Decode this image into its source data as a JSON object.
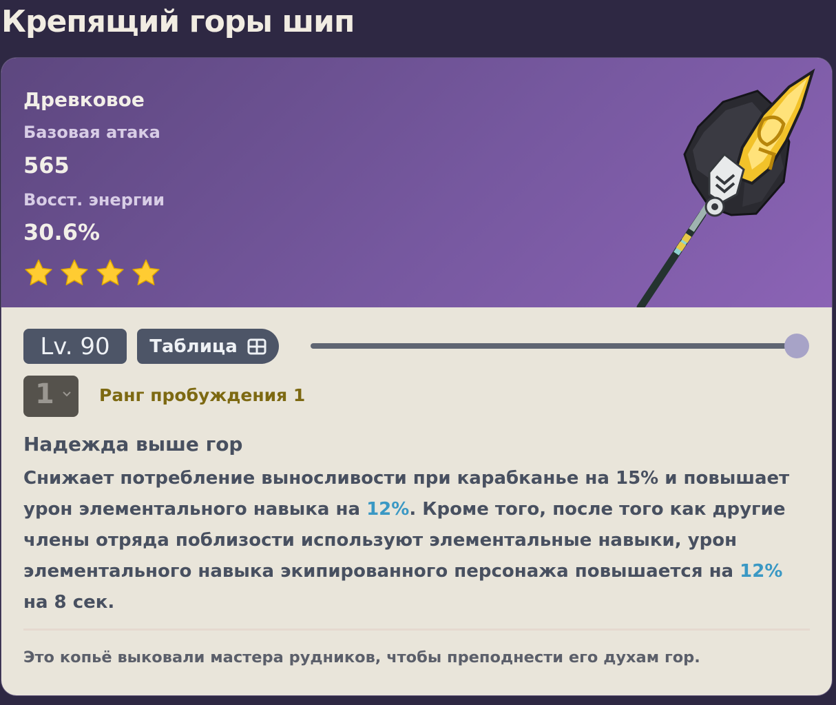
{
  "page": {
    "title": "Крепящий горы шип"
  },
  "weapon": {
    "type": "Древковое",
    "stats": [
      {
        "label": "Базовая атака",
        "value": "565"
      },
      {
        "label": "Восст. энергии",
        "value": "30.6%"
      }
    ],
    "rarity_stars": 4,
    "image_icon": "spear-weapon-icon"
  },
  "controls": {
    "level_label": "Lv. 90",
    "table_button_label": "Таблица",
    "table_icon": "table-grid-icon",
    "level_slider_value": 1.0,
    "refinement_value": "1",
    "refinement_label": "Ранг пробуждения 1"
  },
  "passive": {
    "name": "Надежда выше гор",
    "parts": [
      "Снижает потребление выносливости при карабканье на 15% и повышает урон элементального навыка на ",
      "12%",
      ". Кроме того, после того как другие члены отряда поблизости используют элементальные навыки, урон элементального навыка экипированного персонажа повышается на ",
      "12%",
      " на 8 сек."
    ]
  },
  "lore": "Это копьё выковали мастера рудников, чтобы преподнести его духам гор.",
  "colors": {
    "page_bg": "#2e2843",
    "hero_gradient": [
      "#5d477f",
      "#8b63b5"
    ],
    "card_bg": "#e9e5da",
    "star": "#ffcc32",
    "highlight": "#3a98c4",
    "refinement_text": "#7d6912"
  }
}
